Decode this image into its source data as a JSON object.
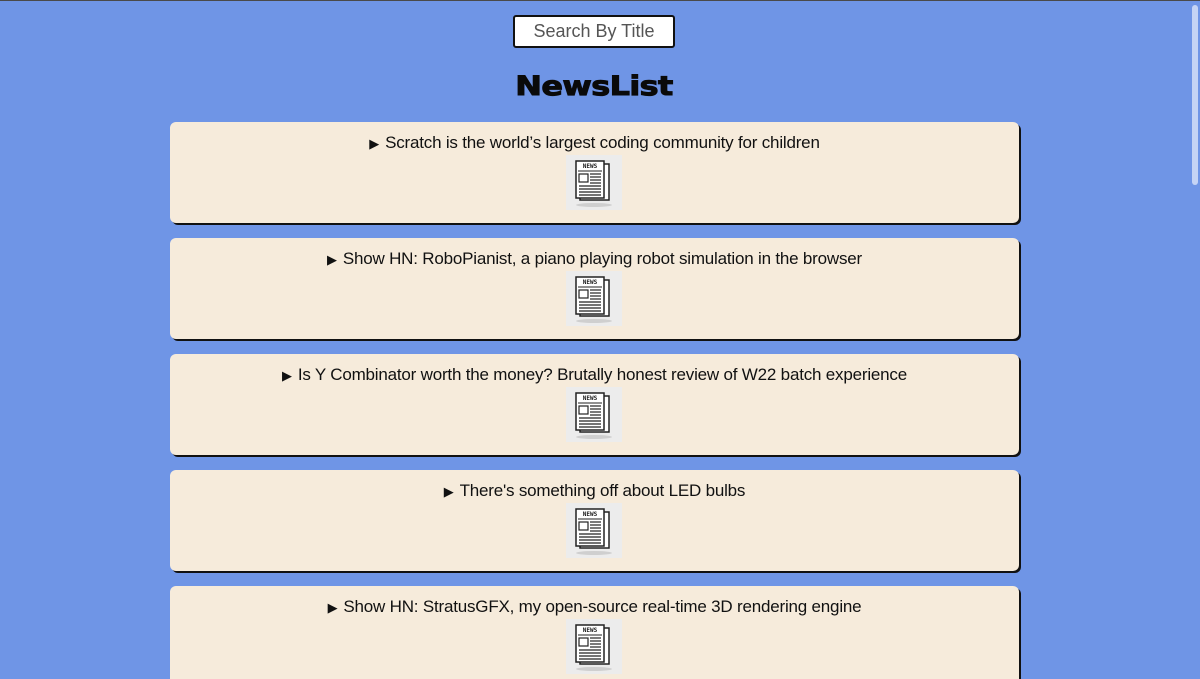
{
  "search": {
    "placeholder": "Search By Title",
    "value": ""
  },
  "page_title": "NewsList",
  "news": [
    {
      "title": "Scratch is the world’s largest coding community for children",
      "icon": "newspaper-icon"
    },
    {
      "title": "Show HN: RoboPianist, a piano playing robot simulation in the browser",
      "icon": "newspaper-icon"
    },
    {
      "title": "Is Y Combinator worth the money? Brutally honest review of W22 batch experience",
      "icon": "newspaper-icon"
    },
    {
      "title": "There's something off about LED bulbs",
      "icon": "newspaper-icon"
    },
    {
      "title": "Show HN: StratusGFX, my open-source real-time 3D rendering engine",
      "icon": "newspaper-icon"
    }
  ],
  "icon_labels": {
    "news": "NEWS"
  },
  "colors": {
    "background": "#6f95e6",
    "card": "#f6ebdb",
    "text": "#111111"
  }
}
